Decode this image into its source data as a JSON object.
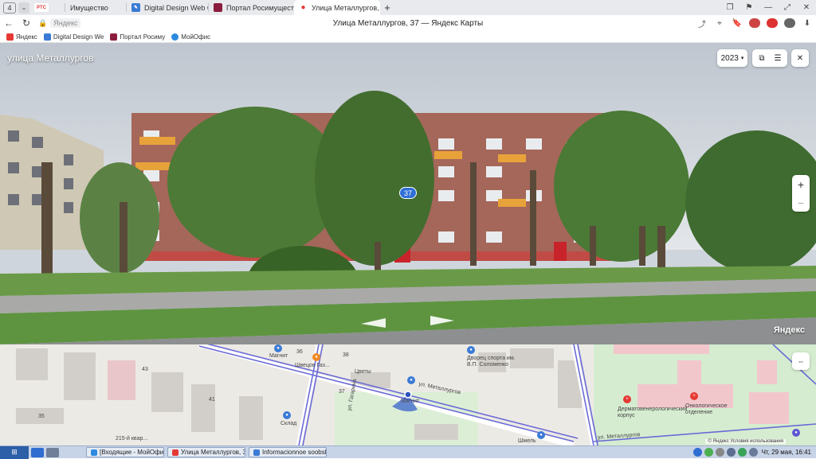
{
  "browser": {
    "tab_count": "4",
    "tabs": [
      {
        "label": "",
        "favicon": "rts-logo-icon",
        "favicon_text": "РТС",
        "color": "#e03a3a"
      },
      {
        "label": "Имущество",
        "favicon": "none",
        "color": "#ffffff"
      },
      {
        "label": "Digital Design Web Client",
        "favicon": "dd-icon",
        "color": "#3b7bd6"
      },
      {
        "label": "Портал Росимущества",
        "favicon": "rosim-icon",
        "color": "#8b1d3e"
      },
      {
        "label": "Улица Металлургов, 37 — Яндекс Карты",
        "short": "Улица Металлургов, 37 — Янд",
        "favicon": "map-pin-icon",
        "color": "#e53935",
        "active": true
      }
    ],
    "address": {
      "domain": "Яндекс",
      "page_title": "Улица Металлургов, 37 — Яндекс Карты"
    },
    "bookmarks": [
      {
        "label": "Яндекс",
        "color": "#e53935"
      },
      {
        "label": "Digital Design We",
        "color": "#3b7bd6"
      },
      {
        "label": "Портал Росиму",
        "color": "#8b1d3e"
      },
      {
        "label": "МойОфис",
        "color": "#2d8ae0"
      }
    ]
  },
  "panorama": {
    "street_name": "улица Металлургов",
    "year": "2023",
    "year_chevron": "▾",
    "house_number": "37",
    "brand": "Яндекс",
    "zoom_in": "+",
    "zoom_out": "−"
  },
  "map": {
    "labels": {
      "magnit1": "Магнит",
      "shvetsov": "Швецов Газ...",
      "tsvety": "Цветы",
      "dvorets": "Дворец спорта им. В.П. Соломенко",
      "magnit2": "Магнит",
      "street1": "ул. Металлургов",
      "street2": "ул. Металлургов",
      "gagarina": "ул. Гагарина",
      "num36": "36",
      "num38": "38",
      "num37": "37",
      "num41": "41",
      "num43": "43",
      "num35": "35",
      "ostrov": "215-й квар...",
      "hospital1": "Дерматовенерологический корпус",
      "hospital2": "Онкологическое отделение",
      "sklad": "Склад",
      "shmel": "Шмель"
    },
    "terms": "© Яндекс   Условия использования"
  },
  "taskbar": {
    "tasks": [
      {
        "label": "[Входящие - МойОфис П...",
        "color": "#2d8ae0"
      },
      {
        "label": "Улица Металлургов, 37 ...",
        "color": "#e53935"
      },
      {
        "label": "Informacionnoe soobshhe...",
        "color": "#3b7bd6"
      }
    ],
    "clock": "Чт, 29 мая, 16:41"
  }
}
